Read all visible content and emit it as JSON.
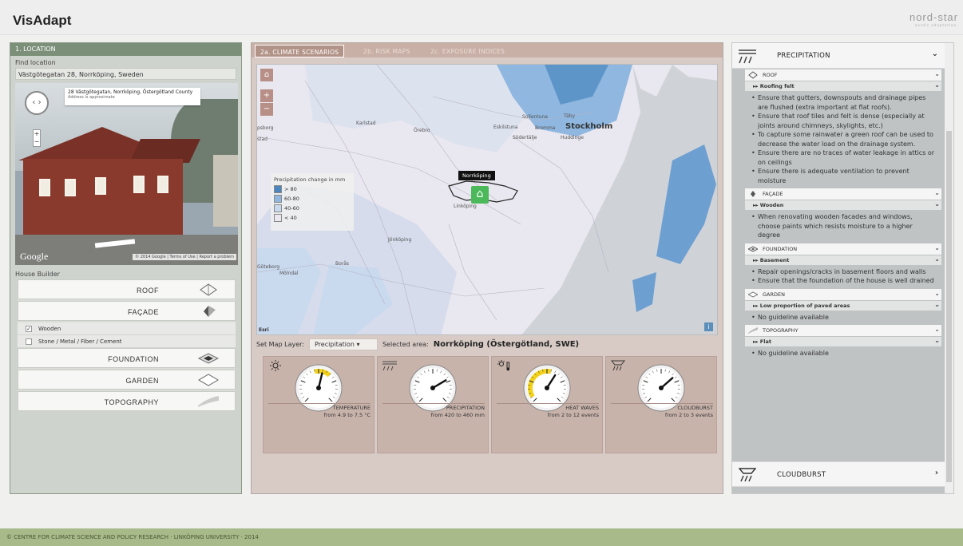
{
  "header": {
    "title": "VisAdapt",
    "brand": "nord-star",
    "brand_sub": "nordic adaptation"
  },
  "left": {
    "panel_title": "1. LOCATION",
    "find_label": "Find location",
    "location_value": "Västgötegatan 28, Norrköping, Sweden",
    "streetview": {
      "address": "28 Västgötegatan, Norrköping, Östergötland County",
      "approx": "Address is approximate",
      "google": "Google",
      "copyright": "© 2014 Google  |  Terms of Use  |  Report a problem"
    },
    "builder_label": "House Builder",
    "items": [
      {
        "label": "ROOF",
        "icon": "roof-icon"
      },
      {
        "label": "FAÇADE",
        "icon": "facade-icon"
      },
      {
        "label": "FOUNDATION",
        "icon": "foundation-icon"
      },
      {
        "label": "GARDEN",
        "icon": "garden-icon"
      },
      {
        "label": "TOPOGRAPHY",
        "icon": "topography-icon"
      }
    ],
    "facade_options": [
      {
        "label": "Wooden",
        "checked": true
      },
      {
        "label": "Stone / Metal / Fiber / Cement",
        "checked": false
      }
    ]
  },
  "mid": {
    "tabs": [
      "2a. CLIMATE SCENARIOS",
      "2b. RISK MAPS",
      "2c. EXPOSURE INDICES"
    ],
    "active_tab": 0,
    "map": {
      "cities": [
        "Karlstad",
        "Örebro",
        "Eskilstuna",
        "Sollentuna",
        "Täby",
        "Bromma",
        "Stockholm",
        "Södertälje",
        "Huddinge",
        "Linköping",
        "Jönköping",
        "Borås",
        "Göteborg",
        "Mölndal",
        "psborg",
        "stad"
      ],
      "legend_title": "Precipitation change in mm",
      "legend": [
        {
          "label": "> 80",
          "color": "#4b86c0"
        },
        {
          "label": "60-80",
          "color": "#8fb7df"
        },
        {
          "label": "40-60",
          "color": "#c9d9ee"
        },
        {
          "label": "< 40",
          "color": "#ebe8f2"
        }
      ],
      "pin_label": "Norrköping",
      "attribution": "Esri"
    },
    "layer_label": "Set Map Layer:",
    "layer_value": "Precipitation",
    "selected_label": "Selected area:",
    "selected_area": "Norrköping (Östergötland, SWE)",
    "gauges": [
      {
        "name": "TEMPERATURE",
        "range": "from 4.9 to 7.5 °C",
        "icon": "sun-icon",
        "needle_fraction": 0.55,
        "zone": [
          0.45,
          0.65
        ]
      },
      {
        "name": "PRECIPITATION",
        "range": "from 420 to 460 mm",
        "icon": "rain-icon",
        "needle_fraction": 0.72,
        "zone": null
      },
      {
        "name": "HEAT WAVES",
        "range": "from 2 to 12 events",
        "icon": "heatwave-icon",
        "needle_fraction": 0.62,
        "zone": [
          0.05,
          0.55
        ]
      },
      {
        "name": "CLOUDBURST",
        "range": "from 2 to 3 events",
        "icon": "cloudburst-icon",
        "needle_fraction": 0.68,
        "zone": null
      }
    ]
  },
  "right": {
    "categories": [
      {
        "title": "PRECIPITATION",
        "expanded": true
      },
      {
        "title": "CLOUDBURST",
        "expanded": false
      }
    ],
    "sections": [
      {
        "title": "ROOF",
        "icon": "roof-icon",
        "sub": "Roofing felt",
        "guides": [
          "Ensure that gutters, downspouts and drainage pipes are flushed (extra important at flat roofs).",
          "Ensure that roof tiles and felt is dense (especially at joints around chimneys, skylights, etc.)",
          "To capture some rainwater a green roof can be used to decrease the water load on the drainage system.",
          "Ensure there are no traces of water leakage in attics or on ceilings",
          "Ensure there is adequate ventilation to prevent moisture"
        ]
      },
      {
        "title": "FAÇADE",
        "icon": "facade-icon",
        "sub": "Wooden",
        "guides": [
          "When renovating wooden facades and windows, choose paints which resists moisture to a higher degree"
        ]
      },
      {
        "title": "FOUNDATION",
        "icon": "foundation-icon",
        "sub": "Basement",
        "guides": [
          "Repair openings/cracks in basement floors and walls",
          "Ensure that the foundation of the house is well drained"
        ]
      },
      {
        "title": "GARDEN",
        "icon": "garden-icon",
        "sub": "Low proportion of paved areas",
        "guides": [
          "No guideline available"
        ]
      },
      {
        "title": "TOPOGRAPHY",
        "icon": "topography-icon",
        "sub": "Flat",
        "guides": [
          "No guideline available"
        ]
      }
    ]
  },
  "footer": "© CENTRE FOR CLIMATE SCIENCE AND POLICY RESEARCH · LINKÖPING UNIVERSITY · 2014"
}
